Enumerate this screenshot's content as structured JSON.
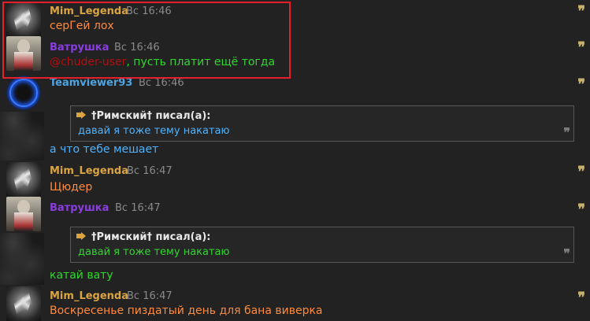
{
  "colors": {
    "background": "#222222",
    "name_mim": "#d9a441",
    "name_vatrushka": "#8a3dde",
    "name_teamviewer": "#4ea3e0",
    "text_orange": "#ff8a3d",
    "text_green": "#31d62f",
    "text_blue": "#4db3ff",
    "mention": "#b01010",
    "highlight": "#e5202a"
  },
  "messages": [
    {
      "author": "Mim_Legenda",
      "time": "Вс 16:46",
      "text": "серГей лох"
    },
    {
      "author": "Ватрушка",
      "time": "Вс 16:46",
      "mention": "@chuder-user",
      "text": ", пусть платит ещё тогда"
    },
    {
      "author": "Teamviewer93",
      "time": "Вс 16:46",
      "quote": {
        "header": "†Римский† писал(а):",
        "text": "давай я тоже тему накатаю"
      },
      "text": "а что тебе мешает"
    },
    {
      "author": "Mim_Legenda",
      "time": "Вс 16:47",
      "text": "Щюдер"
    },
    {
      "author": "Ватрушка",
      "time": "Вс 16:47",
      "quote": {
        "header": "†Римский† писал(а):",
        "text": "давай я тоже тему накатаю"
      },
      "text": "катай вату"
    },
    {
      "author": "Mim_Legenda",
      "time": "Вс 16:47",
      "text": "Воскресенье пиздатый день для бана виверка"
    }
  ],
  "icons": {
    "quote_button": "quote-icon",
    "quote_arrow": "arrow-icon"
  }
}
